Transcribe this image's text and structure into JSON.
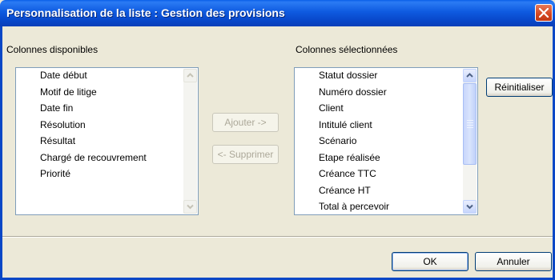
{
  "window": {
    "title": "Personnalisation de la liste : Gestion des provisions"
  },
  "available": {
    "label": "Colonnes disponibles",
    "items": [
      "Date début",
      "Motif de litige",
      "Date fin",
      "Résolution",
      "Résultat",
      "Chargé de recouvrement",
      "Priorité"
    ]
  },
  "selected": {
    "label": "Colonnes sélectionnées",
    "items": [
      "Statut dossier",
      "Numéro dossier",
      "Client",
      "Intitulé client",
      "Scénario",
      "Etape réalisée",
      "Créance TTC",
      "Créance HT",
      "Total à percevoir"
    ]
  },
  "buttons": {
    "add": "Ajouter ->",
    "remove": "<- Supprimer",
    "reset": "Réinitialiser",
    "ok": "OK",
    "cancel": "Annuler"
  },
  "colors": {
    "titlebar": "#0A5FE8",
    "dialog_bg": "#ECE9D8",
    "close_button": "#D44520"
  },
  "icons": {
    "close": "close-icon",
    "scroll_up": "chevron-up-icon",
    "scroll_down": "chevron-down-icon"
  }
}
